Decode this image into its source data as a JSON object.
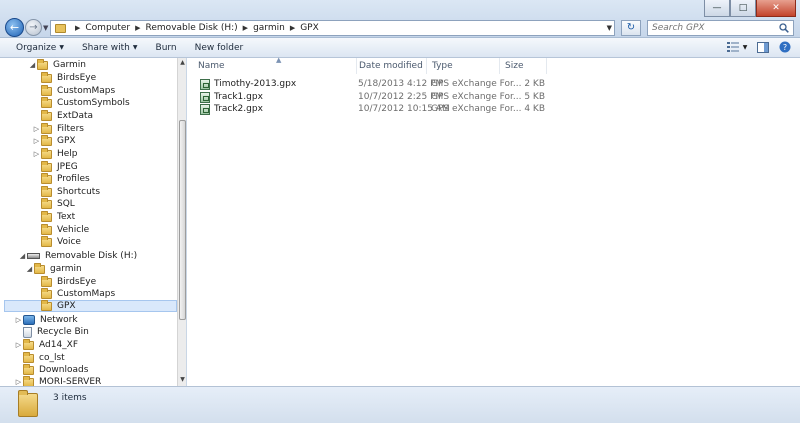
{
  "address": {
    "crumbs": [
      "Computer",
      "Removable Disk (H:)",
      "garmin",
      "GPX"
    ]
  },
  "search": {
    "placeholder": "Search GPX"
  },
  "toolbar": {
    "organize": "Organize",
    "share_with": "Share with",
    "burn": "Burn",
    "new_folder": "New folder"
  },
  "nav": {
    "garmin_root": "Garmin",
    "garmin_children": [
      "BirdsEye",
      "CustomMaps",
      "CustomSymbols",
      "ExtData",
      "Filters",
      "GPX",
      "Help",
      "JPEG",
      "Profiles",
      "Shortcuts",
      "SQL",
      "Text",
      "Vehicle",
      "Voice"
    ],
    "removable_disk": "Removable Disk (H:)",
    "garmin_folder": "garmin",
    "disk_children": [
      "BirdsEye",
      "CustomMaps",
      "GPX"
    ],
    "network": "Network",
    "recycle_bin": "Recycle Bin",
    "others": [
      "Ad14_XF",
      "co_lst",
      "Downloads",
      "MORI-SERVER"
    ]
  },
  "columns": {
    "name": "Name",
    "date": "Date modified",
    "type": "Type",
    "size": "Size"
  },
  "files": [
    {
      "name": "Timothy-2013.gpx",
      "date": "5/18/2013 4:12 PM",
      "type": "GPS eXchange For...",
      "size": "2 KB"
    },
    {
      "name": "Track1.gpx",
      "date": "10/7/2012 2:25 PM",
      "type": "GPS eXchange For...",
      "size": "5 KB"
    },
    {
      "name": "Track2.gpx",
      "date": "10/7/2012 10:15 AM",
      "type": "GPS eXchange For...",
      "size": "4 KB"
    }
  ],
  "status": {
    "items": "3 items"
  }
}
